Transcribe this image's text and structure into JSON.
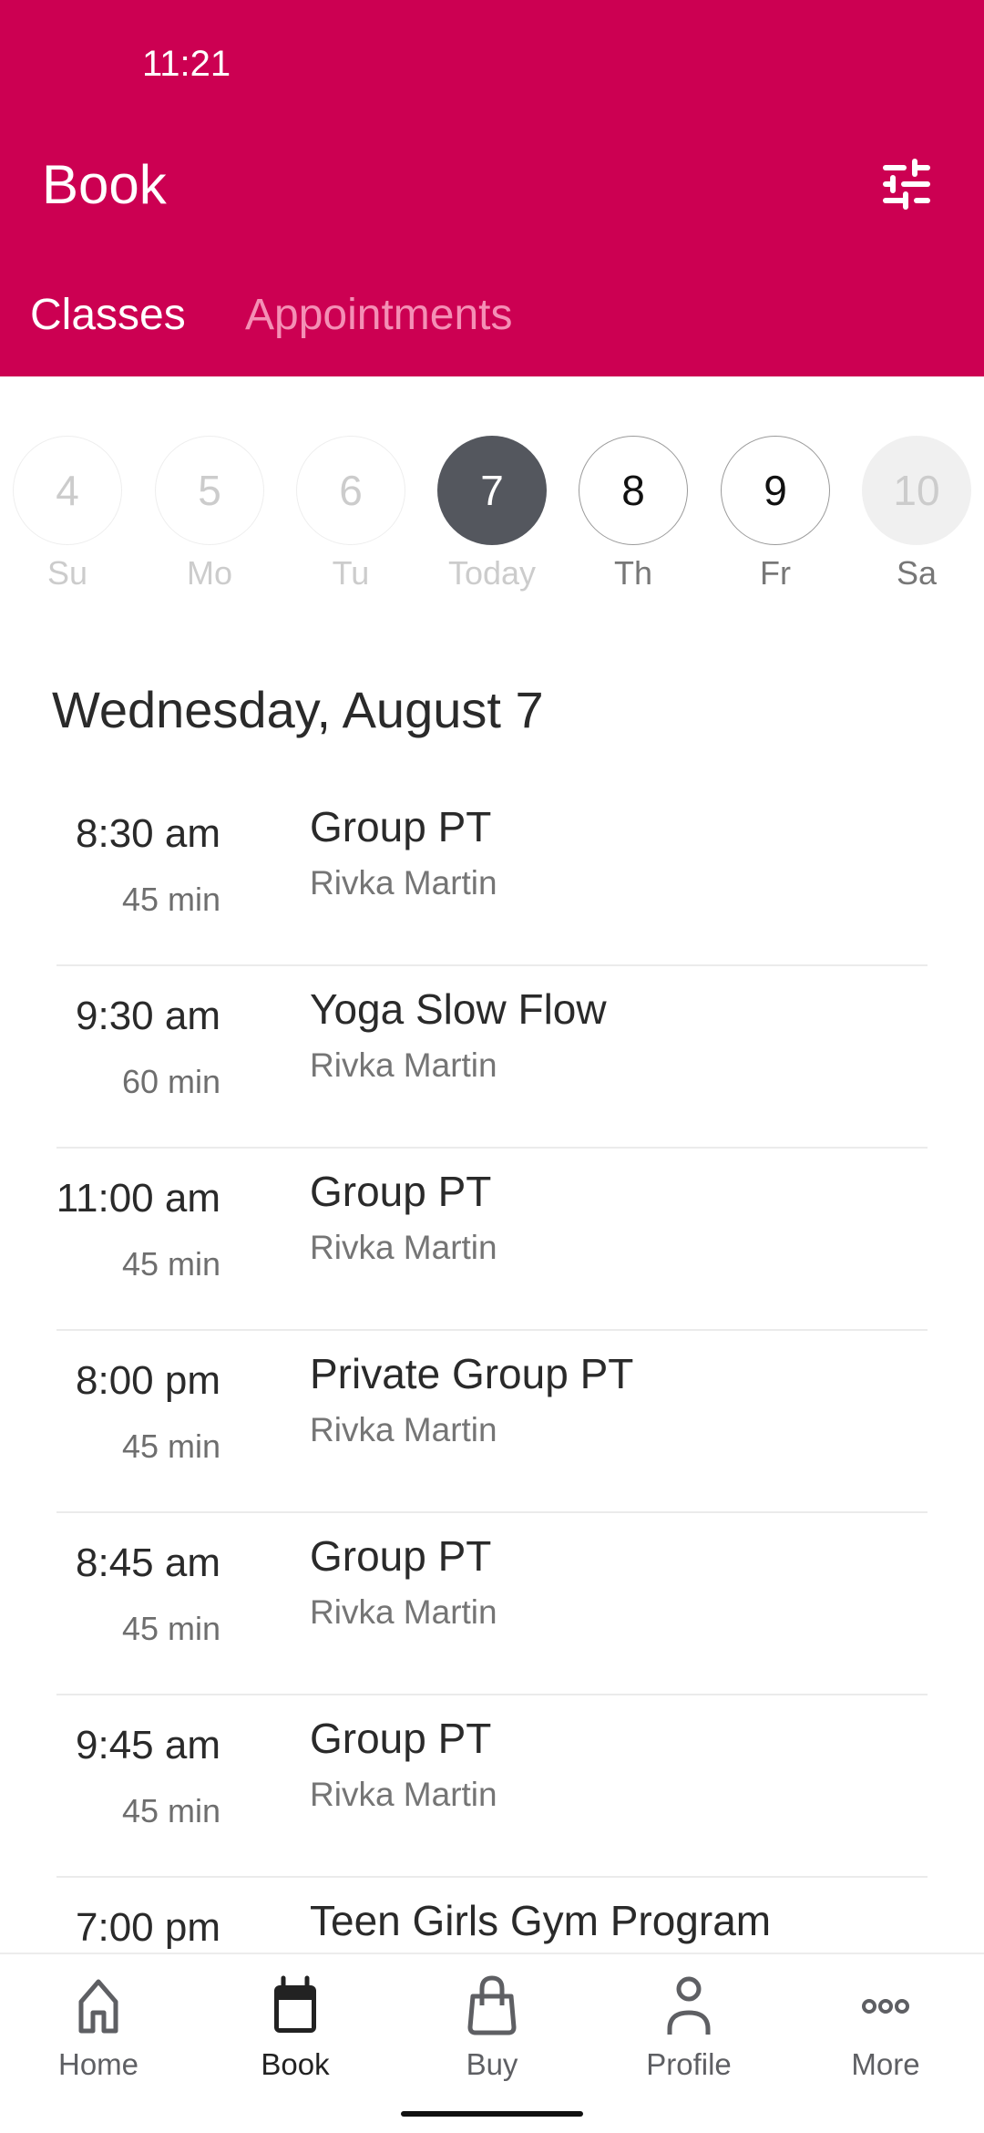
{
  "status_bar": {
    "time": "11:21"
  },
  "header": {
    "title": "Book",
    "filter_icon": "sliders-icon",
    "tabs": [
      {
        "label": "Classes",
        "active": true
      },
      {
        "label": "Appointments",
        "active": false
      }
    ]
  },
  "colors": {
    "brand": "#cc0052",
    "today_circle": "#54575e",
    "inactive_tab": "#f48fb5"
  },
  "days": [
    {
      "number": "4",
      "label": "Su",
      "state": "past"
    },
    {
      "number": "5",
      "label": "Mo",
      "state": "past"
    },
    {
      "number": "6",
      "label": "Tu",
      "state": "past"
    },
    {
      "number": "7",
      "label": "Today",
      "state": "today"
    },
    {
      "number": "8",
      "label": "Th",
      "state": "future"
    },
    {
      "number": "9",
      "label": "Fr",
      "state": "future"
    },
    {
      "number": "10",
      "label": "Sa",
      "state": "disabled"
    }
  ],
  "date_heading": "Wednesday, August 7",
  "classes": [
    {
      "time": "8:30 am",
      "duration": "45 min",
      "name": "Group PT",
      "instructor": "Rivka Martin"
    },
    {
      "time": "9:30 am",
      "duration": "60 min",
      "name": "Yoga Slow Flow",
      "instructor": "Rivka Martin"
    },
    {
      "time": "11:00 am",
      "duration": "45 min",
      "name": "Group PT",
      "instructor": "Rivka Martin"
    },
    {
      "time": "8:00 pm",
      "duration": "45 min",
      "name": "Private Group PT",
      "instructor": "Rivka Martin"
    },
    {
      "time": "8:45 am",
      "duration": "45 min",
      "name": "Group PT",
      "instructor": "Rivka Martin"
    },
    {
      "time": "9:45 am",
      "duration": "45 min",
      "name": "Group PT",
      "instructor": "Rivka Martin"
    },
    {
      "time": "7:00 pm",
      "duration": "",
      "name": "Teen Girls Gym Program",
      "instructor": ""
    }
  ],
  "bottom_nav": [
    {
      "label": "Home",
      "icon": "home-icon",
      "active": false
    },
    {
      "label": "Book",
      "icon": "calendar-icon",
      "active": true
    },
    {
      "label": "Buy",
      "icon": "shopping-bag-icon",
      "active": false
    },
    {
      "label": "Profile",
      "icon": "person-icon",
      "active": false
    },
    {
      "label": "More",
      "icon": "more-dots-icon",
      "active": false
    }
  ]
}
